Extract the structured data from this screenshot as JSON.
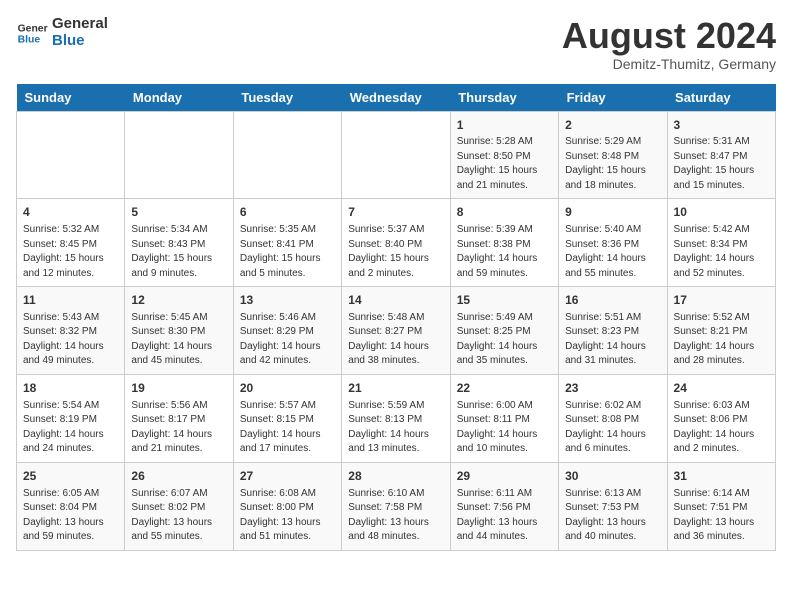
{
  "header": {
    "logo_line1": "General",
    "logo_line2": "Blue",
    "month_year": "August 2024",
    "location": "Demitz-Thumitz, Germany"
  },
  "weekdays": [
    "Sunday",
    "Monday",
    "Tuesday",
    "Wednesday",
    "Thursday",
    "Friday",
    "Saturday"
  ],
  "weeks": [
    [
      {
        "day": "",
        "info": ""
      },
      {
        "day": "",
        "info": ""
      },
      {
        "day": "",
        "info": ""
      },
      {
        "day": "",
        "info": ""
      },
      {
        "day": "1",
        "info": "Sunrise: 5:28 AM\nSunset: 8:50 PM\nDaylight: 15 hours\nand 21 minutes."
      },
      {
        "day": "2",
        "info": "Sunrise: 5:29 AM\nSunset: 8:48 PM\nDaylight: 15 hours\nand 18 minutes."
      },
      {
        "day": "3",
        "info": "Sunrise: 5:31 AM\nSunset: 8:47 PM\nDaylight: 15 hours\nand 15 minutes."
      }
    ],
    [
      {
        "day": "4",
        "info": "Sunrise: 5:32 AM\nSunset: 8:45 PM\nDaylight: 15 hours\nand 12 minutes."
      },
      {
        "day": "5",
        "info": "Sunrise: 5:34 AM\nSunset: 8:43 PM\nDaylight: 15 hours\nand 9 minutes."
      },
      {
        "day": "6",
        "info": "Sunrise: 5:35 AM\nSunset: 8:41 PM\nDaylight: 15 hours\nand 5 minutes."
      },
      {
        "day": "7",
        "info": "Sunrise: 5:37 AM\nSunset: 8:40 PM\nDaylight: 15 hours\nand 2 minutes."
      },
      {
        "day": "8",
        "info": "Sunrise: 5:39 AM\nSunset: 8:38 PM\nDaylight: 14 hours\nand 59 minutes."
      },
      {
        "day": "9",
        "info": "Sunrise: 5:40 AM\nSunset: 8:36 PM\nDaylight: 14 hours\nand 55 minutes."
      },
      {
        "day": "10",
        "info": "Sunrise: 5:42 AM\nSunset: 8:34 PM\nDaylight: 14 hours\nand 52 minutes."
      }
    ],
    [
      {
        "day": "11",
        "info": "Sunrise: 5:43 AM\nSunset: 8:32 PM\nDaylight: 14 hours\nand 49 minutes."
      },
      {
        "day": "12",
        "info": "Sunrise: 5:45 AM\nSunset: 8:30 PM\nDaylight: 14 hours\nand 45 minutes."
      },
      {
        "day": "13",
        "info": "Sunrise: 5:46 AM\nSunset: 8:29 PM\nDaylight: 14 hours\nand 42 minutes."
      },
      {
        "day": "14",
        "info": "Sunrise: 5:48 AM\nSunset: 8:27 PM\nDaylight: 14 hours\nand 38 minutes."
      },
      {
        "day": "15",
        "info": "Sunrise: 5:49 AM\nSunset: 8:25 PM\nDaylight: 14 hours\nand 35 minutes."
      },
      {
        "day": "16",
        "info": "Sunrise: 5:51 AM\nSunset: 8:23 PM\nDaylight: 14 hours\nand 31 minutes."
      },
      {
        "day": "17",
        "info": "Sunrise: 5:52 AM\nSunset: 8:21 PM\nDaylight: 14 hours\nand 28 minutes."
      }
    ],
    [
      {
        "day": "18",
        "info": "Sunrise: 5:54 AM\nSunset: 8:19 PM\nDaylight: 14 hours\nand 24 minutes."
      },
      {
        "day": "19",
        "info": "Sunrise: 5:56 AM\nSunset: 8:17 PM\nDaylight: 14 hours\nand 21 minutes."
      },
      {
        "day": "20",
        "info": "Sunrise: 5:57 AM\nSunset: 8:15 PM\nDaylight: 14 hours\nand 17 minutes."
      },
      {
        "day": "21",
        "info": "Sunrise: 5:59 AM\nSunset: 8:13 PM\nDaylight: 14 hours\nand 13 minutes."
      },
      {
        "day": "22",
        "info": "Sunrise: 6:00 AM\nSunset: 8:11 PM\nDaylight: 14 hours\nand 10 minutes."
      },
      {
        "day": "23",
        "info": "Sunrise: 6:02 AM\nSunset: 8:08 PM\nDaylight: 14 hours\nand 6 minutes."
      },
      {
        "day": "24",
        "info": "Sunrise: 6:03 AM\nSunset: 8:06 PM\nDaylight: 14 hours\nand 2 minutes."
      }
    ],
    [
      {
        "day": "25",
        "info": "Sunrise: 6:05 AM\nSunset: 8:04 PM\nDaylight: 13 hours\nand 59 minutes."
      },
      {
        "day": "26",
        "info": "Sunrise: 6:07 AM\nSunset: 8:02 PM\nDaylight: 13 hours\nand 55 minutes."
      },
      {
        "day": "27",
        "info": "Sunrise: 6:08 AM\nSunset: 8:00 PM\nDaylight: 13 hours\nand 51 minutes."
      },
      {
        "day": "28",
        "info": "Sunrise: 6:10 AM\nSunset: 7:58 PM\nDaylight: 13 hours\nand 48 minutes."
      },
      {
        "day": "29",
        "info": "Sunrise: 6:11 AM\nSunset: 7:56 PM\nDaylight: 13 hours\nand 44 minutes."
      },
      {
        "day": "30",
        "info": "Sunrise: 6:13 AM\nSunset: 7:53 PM\nDaylight: 13 hours\nand 40 minutes."
      },
      {
        "day": "31",
        "info": "Sunrise: 6:14 AM\nSunset: 7:51 PM\nDaylight: 13 hours\nand 36 minutes."
      }
    ]
  ]
}
